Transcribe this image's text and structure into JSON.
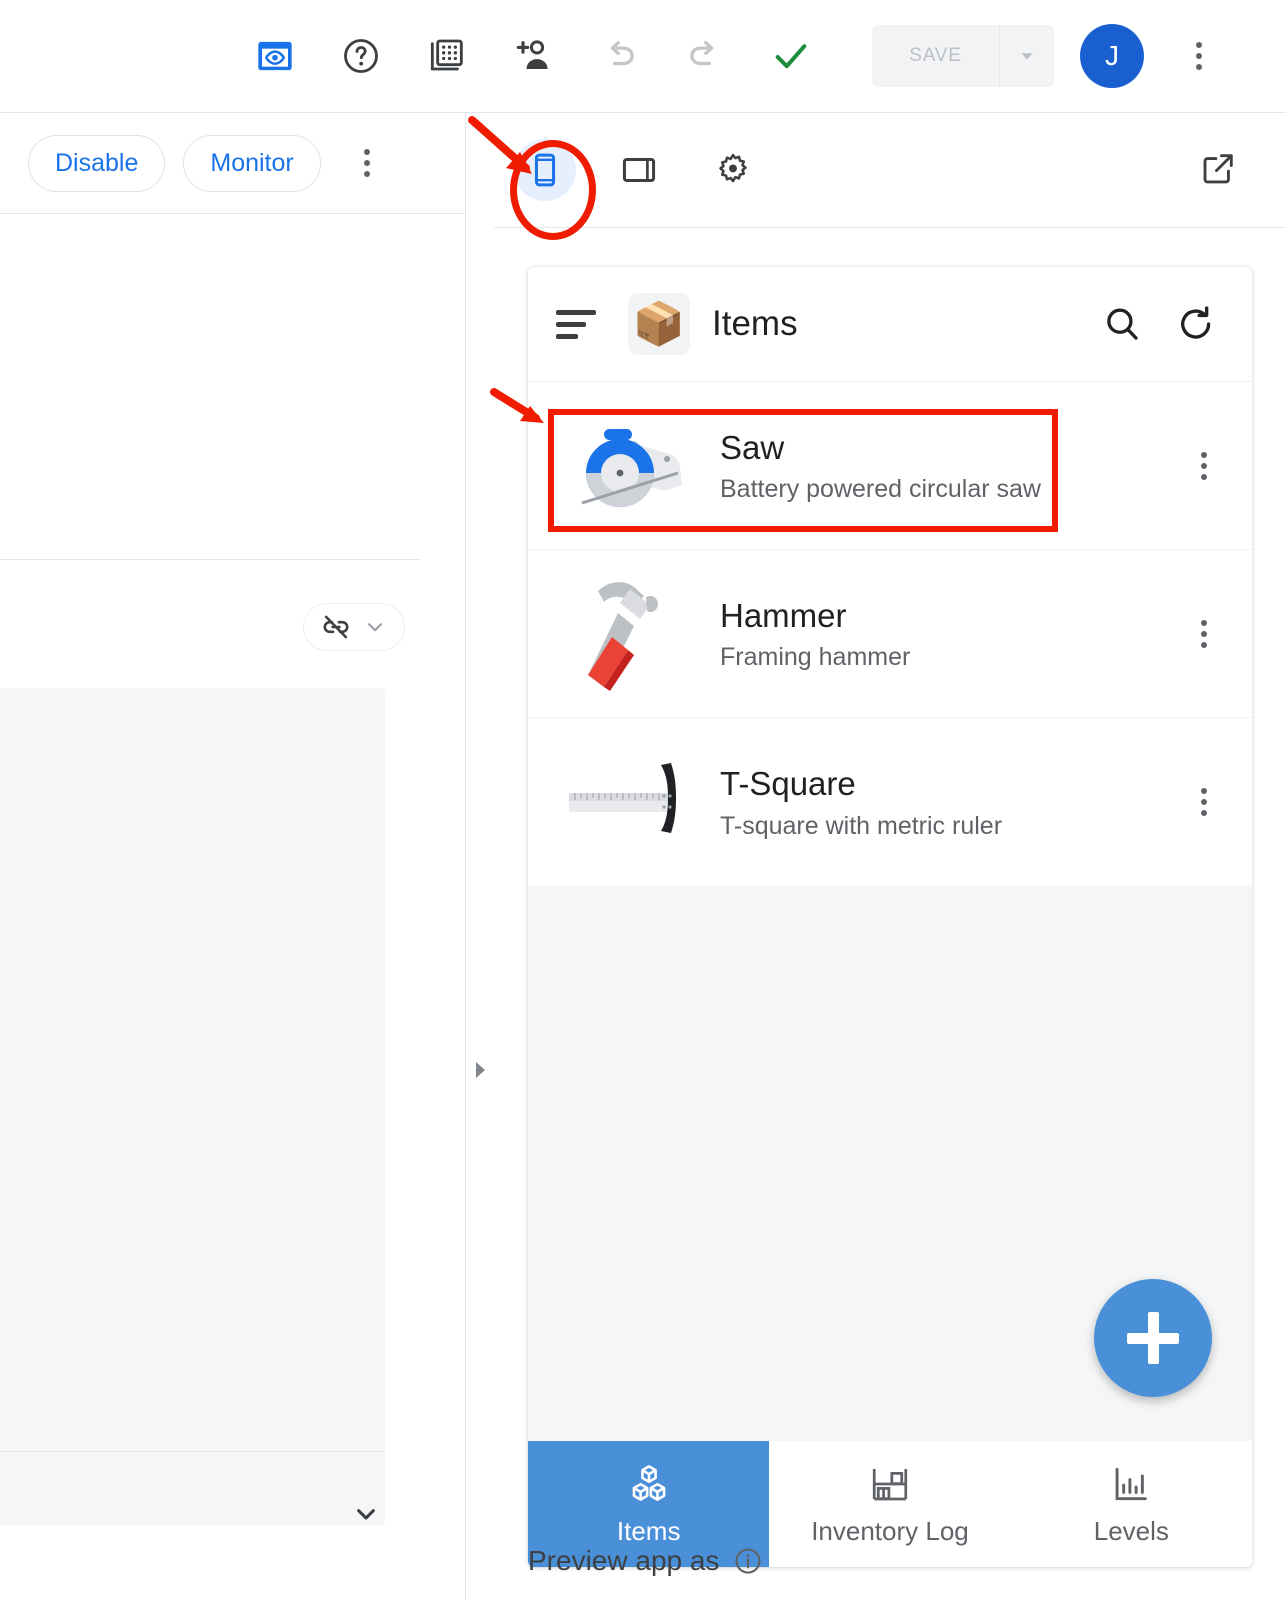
{
  "toolbar": {
    "icons": [
      {
        "name": "preview-eye-icon",
        "label": "Preview",
        "active": true
      },
      {
        "name": "help-icon",
        "label": "Help"
      },
      {
        "name": "data-grid-icon",
        "label": "Data"
      },
      {
        "name": "add-person-icon",
        "label": "Share"
      },
      {
        "name": "undo-icon",
        "label": "Undo",
        "disabled": true
      },
      {
        "name": "redo-icon",
        "label": "Redo",
        "disabled": true
      },
      {
        "name": "check-icon",
        "label": "Saved"
      }
    ],
    "save_label": "SAVE",
    "save_disabled": true,
    "save_caret": "▾",
    "avatar_initial": "J",
    "overflow_label": "More options",
    "accent_blue": "#1a73e8",
    "check_green": "#1e8e3e",
    "avatar_color": "#1a5fd0"
  },
  "left_panel": {
    "buttons": [
      {
        "label": "Disable",
        "name": "disable-button"
      },
      {
        "label": "Monitor",
        "name": "monitor-button"
      }
    ],
    "overflow_label": "More options",
    "link_chip": {
      "icon": "link-off-icon",
      "caret": "⌄"
    },
    "collapse_caret": "⌄"
  },
  "split_handle": {
    "icon": "expand-right-triangle"
  },
  "preview_toolbar": {
    "modes": [
      {
        "name": "phone-icon",
        "label": "Phone",
        "active": true
      },
      {
        "name": "tablet-icon",
        "label": "Tablet",
        "active": false
      },
      {
        "name": "settings-gear-icon",
        "label": "Settings",
        "active": false
      }
    ],
    "open_external_label": "Open in new window"
  },
  "app": {
    "app_bar": {
      "menu_icon": "hamburger-menu-icon",
      "logo_emoji": "📦",
      "title": "Items",
      "search_icon": "search-icon",
      "refresh_icon": "refresh-icon"
    },
    "items": [
      {
        "title": "Saw",
        "subtitle": "Battery powered circular saw",
        "thumb": "circular-saw-illustration",
        "highlighted": true
      },
      {
        "title": "Hammer",
        "subtitle": "Framing hammer",
        "thumb": "hammer-illustration",
        "highlighted": false
      },
      {
        "title": "T-Square",
        "subtitle": "T-square with metric ruler",
        "thumb": "t-square-illustration",
        "highlighted": false
      }
    ],
    "fab": {
      "icon": "plus-icon",
      "label": "Add item",
      "color": "#4a90d9"
    },
    "bottom_nav": [
      {
        "label": "Items",
        "icon": "cubes-icon",
        "active": true
      },
      {
        "label": "Inventory Log",
        "icon": "shelf-icon",
        "active": false
      },
      {
        "label": "Levels",
        "icon": "bar-chart-icon",
        "active": false
      }
    ]
  },
  "footer": {
    "preview_as_label": "Preview app as",
    "info_icon": "info-icon"
  },
  "annotations": {
    "color": "#f01c00",
    "ellipse_target": "phone-preview-mode-button",
    "box_target": "saw-list-item"
  }
}
